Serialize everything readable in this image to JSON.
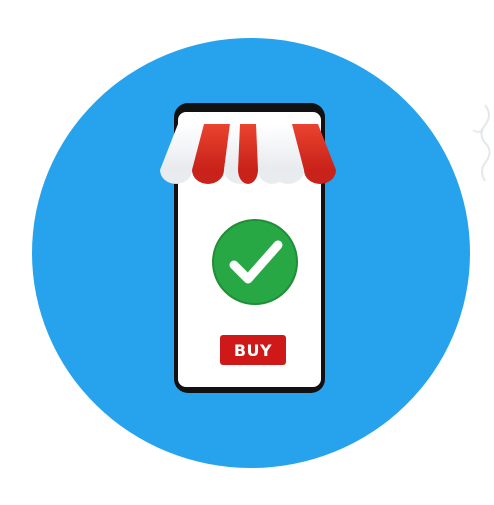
{
  "illustration": {
    "circle_color": "#26a3ec",
    "phone_frame_color": "#111111",
    "awning_stripe_colors": [
      "#ffffff",
      "#e33a2a"
    ],
    "check_badge_color": "#27a844",
    "buy_button": {
      "label": "BUY",
      "color": "#cf1818"
    },
    "icons": [
      "storefront-awning-icon",
      "checkmark-icon"
    ]
  }
}
